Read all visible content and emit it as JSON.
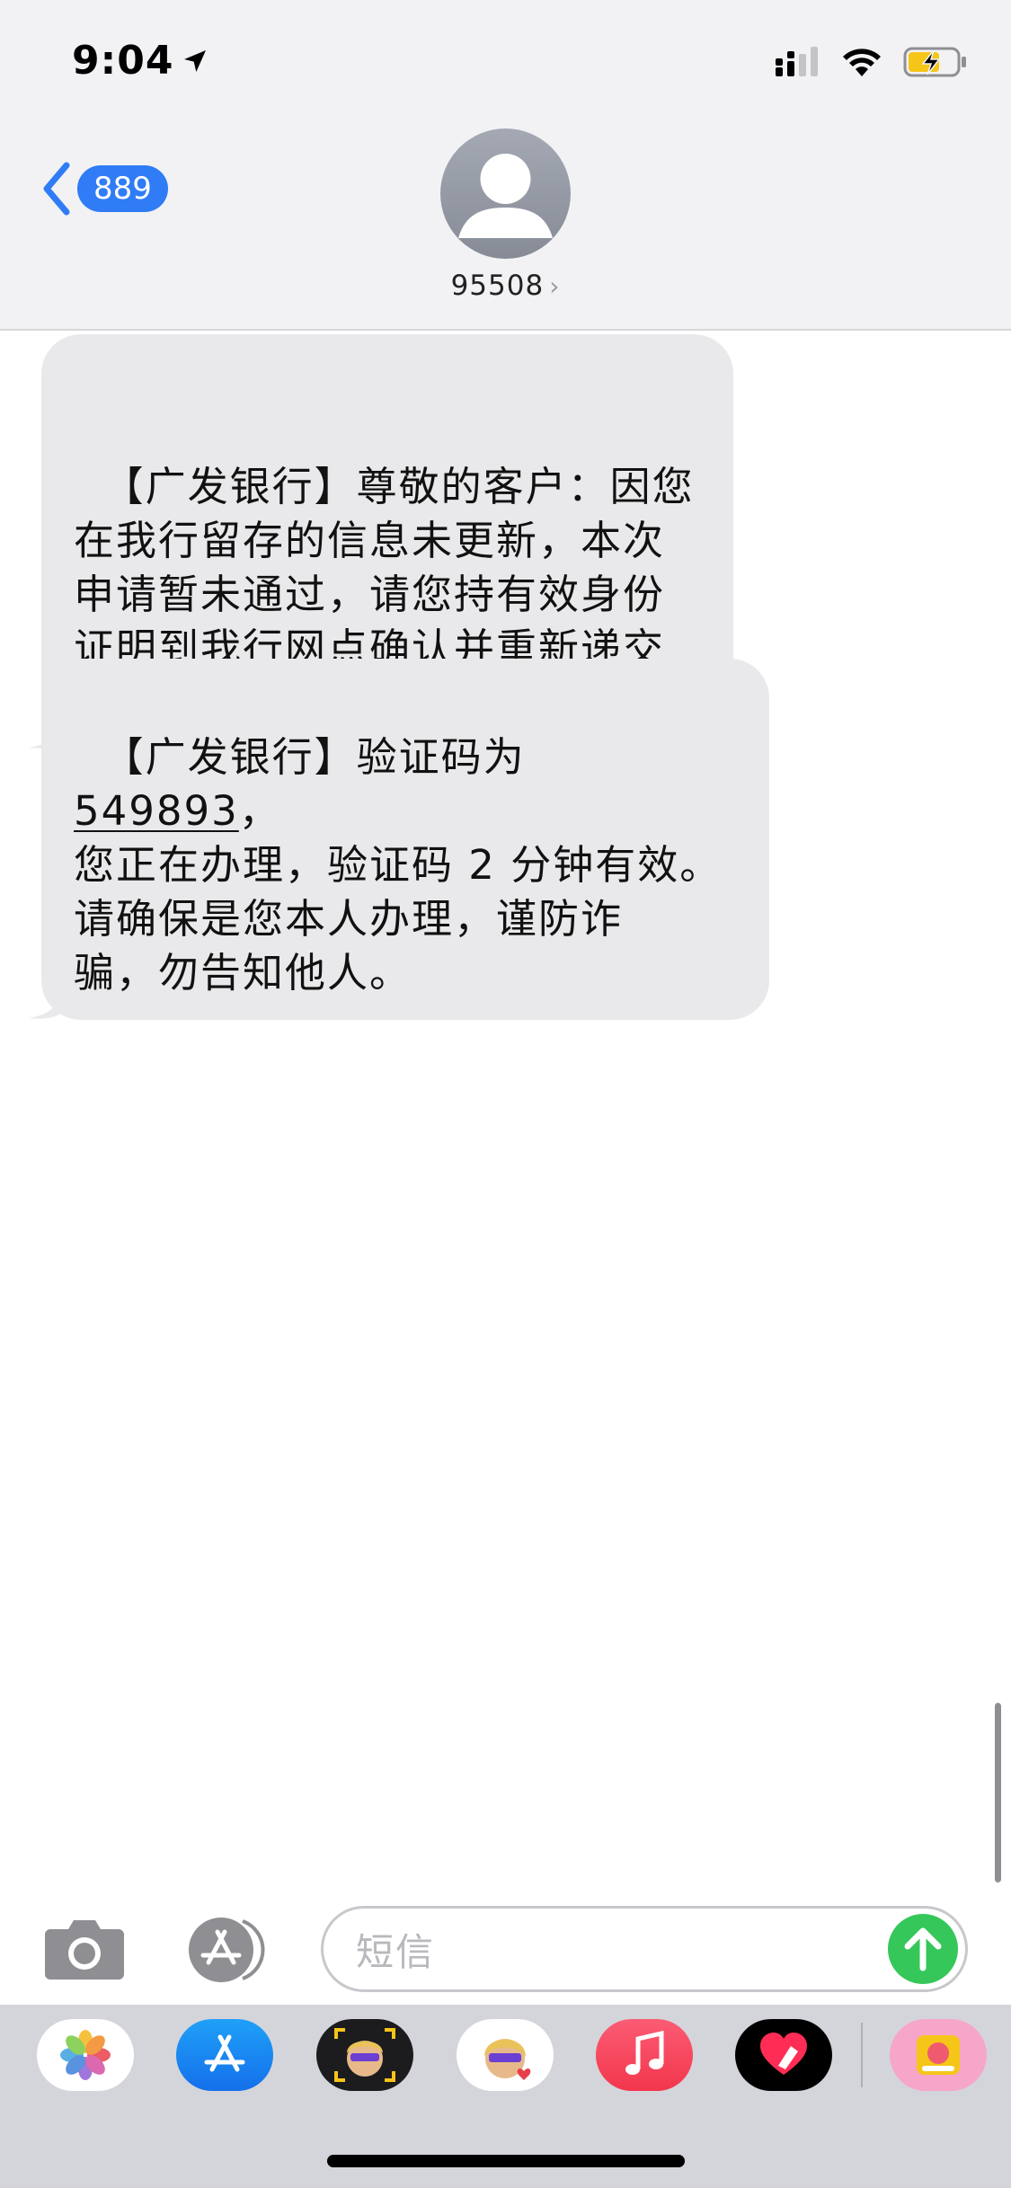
{
  "status_bar": {
    "time": "9:04",
    "battery_color": "#f5c518"
  },
  "header": {
    "back_count": "889",
    "contact": "95508",
    "contact_chevron": "›"
  },
  "messages": [
    {
      "sender": "95508",
      "text": "【广发银行】尊敬的客户：因您\n在我行留存的信息未更新，本次\n申请暂未通过，请您持有效身份\n证明到我行网点确认并重新递交\n信用卡申请。感谢您的支持。"
    },
    {
      "sender": "95508",
      "text_before": "【广发银行】验证码为 ",
      "code": "549893",
      "text_after": "，\n您正在办理，验证码 2 分钟有效。\n请确保是您本人办理，谨防诈\n骗，勿告知他人。"
    }
  ],
  "composer": {
    "placeholder": "短信"
  },
  "app_drawer": {
    "apps": [
      "photos-app",
      "app-store-app",
      "memoji-camera-app",
      "memoji-stickers-app",
      "music-app",
      "digital-touch-app",
      "sticker-app"
    ]
  },
  "colors": {
    "accent": "#2f7cf6",
    "bubble_gray": "#e9e9eb",
    "send_green": "#35c759"
  }
}
